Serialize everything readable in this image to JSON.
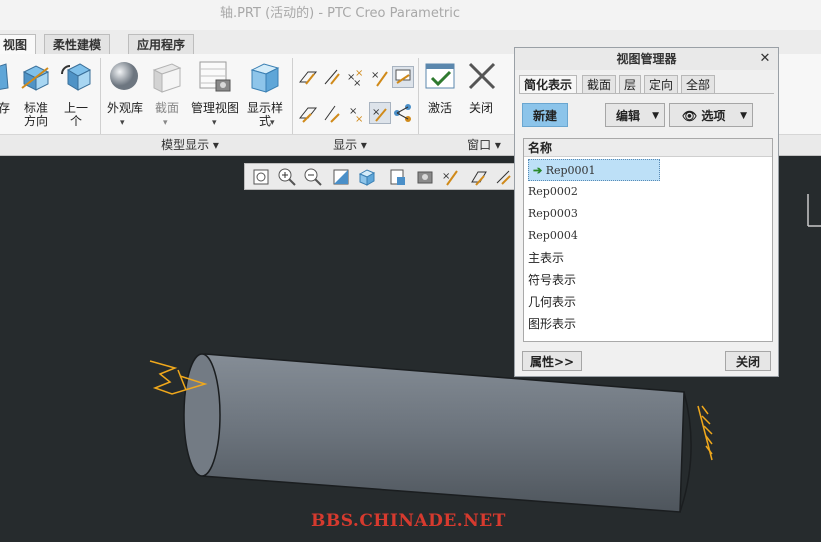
{
  "window": {
    "title": "轴.PRT (活动的) - PTC Creo Parametric"
  },
  "ribbon_tabs": [
    {
      "label": "视图",
      "active": true
    },
    {
      "label": "柔性建模",
      "active": false
    },
    {
      "label": "应用程序",
      "active": false
    }
  ],
  "ribbon": {
    "orient_buttons": {
      "save_label": "存",
      "standard_label": "标准\n方向",
      "previous_label": "上一\n个"
    },
    "model_display": {
      "appearance_label": "外观库",
      "section_label": "截面",
      "manage_views_label": "管理视图",
      "display_style_label": "显示样\n式",
      "group_label": "模型显示"
    },
    "show_group_label": "显示",
    "window_group": {
      "activate_label": "激活",
      "close_label": "关闭",
      "group_label": "窗口"
    }
  },
  "view_manager": {
    "title": "视图管理器",
    "tabs": [
      {
        "label": "简化表示",
        "active": true
      },
      {
        "label": "截面",
        "active": false
      },
      {
        "label": "层",
        "active": false
      },
      {
        "label": "定向",
        "active": false
      },
      {
        "label": "全部",
        "active": false
      }
    ],
    "new_label": "新建",
    "edit_label": "编辑",
    "options_label": "选项",
    "column_name": "名称",
    "items": [
      {
        "label": "Rep0001",
        "active": true
      },
      {
        "label": "Rep0002",
        "active": false
      },
      {
        "label": "Rep0003",
        "active": false
      },
      {
        "label": "Rep0004",
        "active": false
      },
      {
        "label": "主表示",
        "active": false
      },
      {
        "label": "符号表示",
        "active": false
      },
      {
        "label": "几何表示",
        "active": false
      },
      {
        "label": "图形表示",
        "active": false
      }
    ],
    "properties_label": "属性>>",
    "close_label": "关闭"
  },
  "watermark": "BBS.CHINADE.NET",
  "colors": {
    "background": "#262b2d",
    "model": "#6f7780",
    "datum": "#f0a81c",
    "accent": "#8cc4ea"
  }
}
